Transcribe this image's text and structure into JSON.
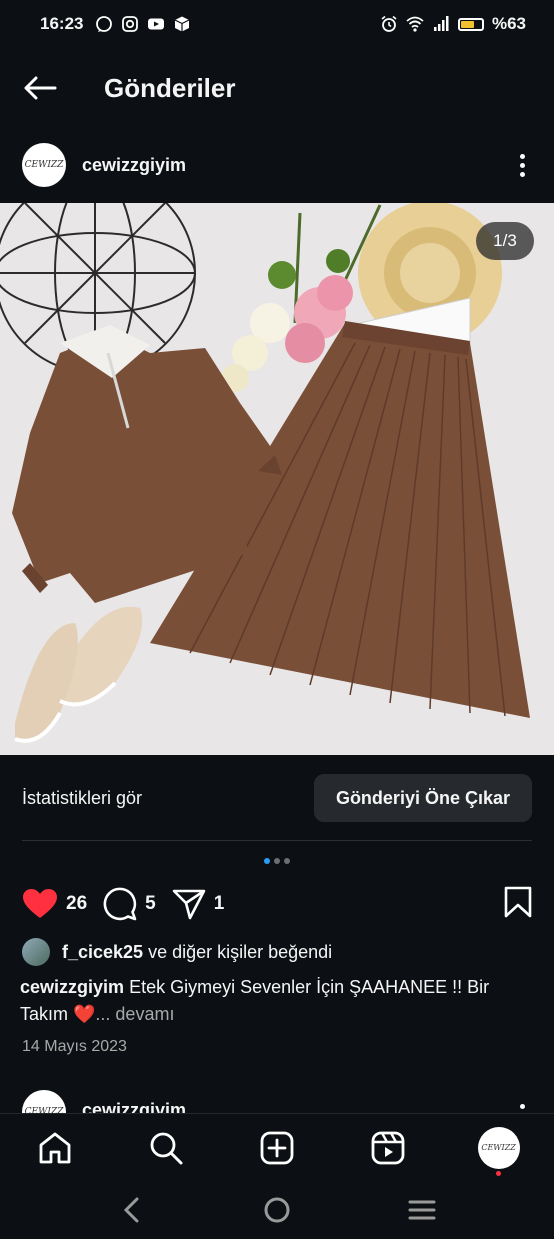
{
  "status_bar": {
    "time": "16:23",
    "battery": "%63",
    "battery_level": 0.63,
    "left_icons": [
      "whatsapp-icon",
      "instagram-icon",
      "youtube-icon",
      "box-icon"
    ],
    "right_icons": [
      "alarm-icon",
      "wifi-icon",
      "signal-icon",
      "battery-icon"
    ]
  },
  "header": {
    "title": "Gönderiler"
  },
  "post": {
    "username": "cewizzgiyim",
    "avatar_text": "CEWIZZ",
    "image_counter": "1/3",
    "stats_link": "İstatistikleri gör",
    "boost_button": "Gönderiyi Öne Çıkar",
    "carousel": {
      "total": 3,
      "active": 1
    },
    "likes_count": "26",
    "comments_count": "5",
    "shares_count": "1",
    "liked_by_user": "f_cicek25",
    "liked_by_suffix": "ve diğer kişiler beğendi",
    "caption_user": "cewizzgiyim",
    "caption_text": "Etek Giymeyi Sevenler İçin ŞAAHANEE !! Bir Takım ❤️",
    "caption_more": "... devamı",
    "date": "14 Mayıs 2023"
  },
  "next_post": {
    "username": "cewizzgiyim"
  },
  "colors": {
    "background": "#0c1014",
    "like_red": "#ff3040",
    "active_dot": "#2a9df4",
    "button_bg": "#262a2f",
    "battery_yellow": "#f2c12e",
    "image_bg": "#e9e6e8",
    "brown": "#7a4f38"
  }
}
